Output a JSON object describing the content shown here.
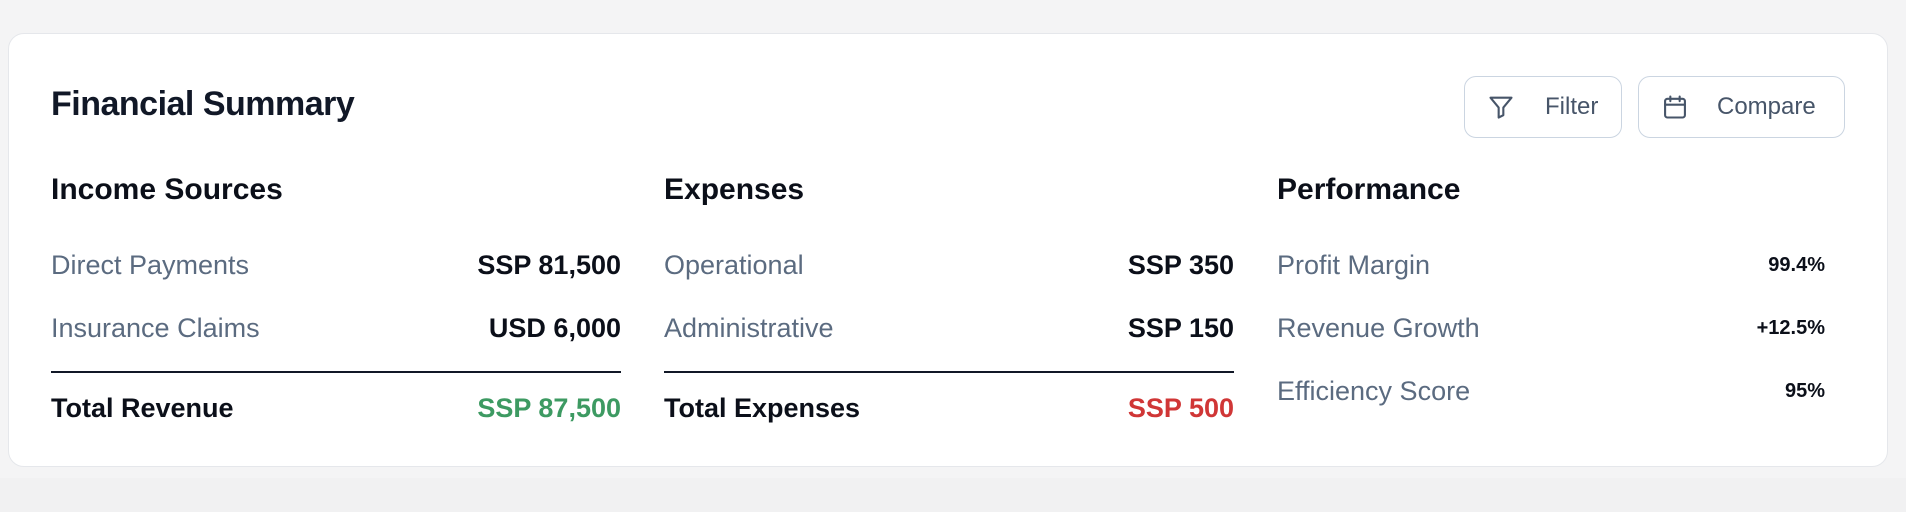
{
  "card": {
    "title": "Financial Summary",
    "filter_label": "Filter",
    "compare_label": "Compare"
  },
  "income": {
    "title": "Income Sources",
    "items": [
      {
        "label": "Direct Payments",
        "value": "SSP 81,500"
      },
      {
        "label": "Insurance Claims",
        "value": "USD 6,000"
      }
    ],
    "total_label": "Total Revenue",
    "total_value": "SSP 87,500"
  },
  "expenses": {
    "title": "Expenses",
    "items": [
      {
        "label": "Operational",
        "value": "SSP 350"
      },
      {
        "label": "Administrative",
        "value": "SSP 150"
      }
    ],
    "total_label": "Total Expenses",
    "total_value": "SSP 500"
  },
  "performance": {
    "title": "Performance",
    "items": [
      {
        "label": "Profit Margin",
        "value": "99.4%"
      },
      {
        "label": "Revenue Growth",
        "value": "+12.5%"
      },
      {
        "label": "Efficiency Score",
        "value": "95%"
      }
    ]
  },
  "colors": {
    "positive": "#3d9a62",
    "negative": "#d03636"
  },
  "icons": {
    "filter": "filter-icon",
    "compare": "calendar-icon"
  }
}
